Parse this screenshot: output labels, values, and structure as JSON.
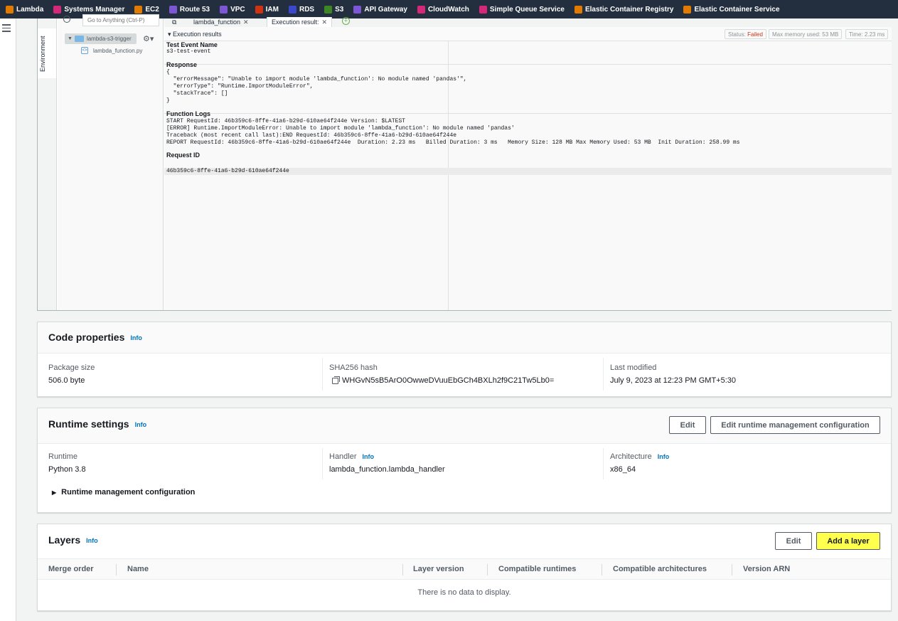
{
  "favorites": [
    {
      "label": "Lambda",
      "icon": "lambda-icon",
      "color": "#e07b00"
    },
    {
      "label": "Systems Manager",
      "icon": "systems-manager-icon",
      "color": "#d6287a"
    },
    {
      "label": "EC2",
      "icon": "ec2-icon",
      "color": "#e07b00"
    },
    {
      "label": "Route 53",
      "icon": "route53-icon",
      "color": "#7d56d6"
    },
    {
      "label": "VPC",
      "icon": "vpc-icon",
      "color": "#7d56d6"
    },
    {
      "label": "IAM",
      "icon": "iam-icon",
      "color": "#d13212"
    },
    {
      "label": "RDS",
      "icon": "rds-icon",
      "color": "#3b48cc"
    },
    {
      "label": "S3",
      "icon": "s3-icon",
      "color": "#3e8624"
    },
    {
      "label": "API Gateway",
      "icon": "api-gateway-icon",
      "color": "#7d56d6"
    },
    {
      "label": "CloudWatch",
      "icon": "cloudwatch-icon",
      "color": "#d6287a"
    },
    {
      "label": "Simple Queue Service",
      "icon": "sqs-icon",
      "color": "#d6287a"
    },
    {
      "label": "Elastic Container Registry",
      "icon": "ecr-icon",
      "color": "#e07b00"
    },
    {
      "label": "Elastic Container Service",
      "icon": "ecs-icon",
      "color": "#e07b00"
    }
  ],
  "ide": {
    "environment_label": "Environment",
    "search_placeholder": "Go to Anything (Ctrl-P)",
    "folder_name": "lambda-s3-trigger",
    "file_name": "lambda_function.py",
    "tabs": [
      {
        "label": "lambda_function"
      },
      {
        "label": "Execution result:"
      }
    ],
    "results": {
      "title": "Execution results",
      "status_label": "Status:",
      "status_value": "Failed",
      "max_memory": "Max memory used: 53 MB",
      "time": "Time: 2.23 ms",
      "test_event_title": "Test Event Name",
      "test_event_value": "s3-test-event",
      "response_title": "Response",
      "response_lines": [
        "{",
        "  \"errorMessage\": \"Unable to import module 'lambda_function': No module named 'pandas'\",",
        "  \"errorType\": \"Runtime.ImportModuleError\",",
        "  \"stackTrace\": []",
        "}"
      ],
      "logs_title": "Function Logs",
      "log_lines": [
        "START RequestId: 46b359c6-8ffe-41a6-b29d-610ae64f244e Version: $LATEST",
        "[ERROR] Runtime.ImportModuleError: Unable to import module 'lambda_function': No module named 'pandas'",
        "Traceback (most recent call last):END RequestId: 46b359c6-8ffe-41a6-b29d-610ae64f244e",
        "REPORT RequestId: 46b359c6-8ffe-41a6-b29d-610ae64f244e  Duration: 2.23 ms   Billed Duration: 3 ms   Memory Size: 128 MB Max Memory Used: 53 MB  Init Duration: 258.99 ms"
      ],
      "request_id_title": "Request ID",
      "request_id_value": "46b359c6-8ffe-41a6-b29d-610ae64f244e"
    }
  },
  "code_properties": {
    "title": "Code properties",
    "info": "Info",
    "package_size_label": "Package size",
    "package_size_value": "506.0 byte",
    "sha_label": "SHA256 hash",
    "sha_value": "WHGvN5sB5ArO0OwweDVuuEbGCh4BXLh2f9C21Tw5Lb0=",
    "last_modified_label": "Last modified",
    "last_modified_value": "July 9, 2023 at 12:23 PM GMT+5:30"
  },
  "runtime_settings": {
    "title": "Runtime settings",
    "info": "Info",
    "edit_label": "Edit",
    "edit_runtime_mgmt_label": "Edit runtime management configuration",
    "runtime_label": "Runtime",
    "runtime_value": "Python 3.8",
    "handler_label": "Handler",
    "handler_info": "Info",
    "handler_value": "lambda_function.lambda_handler",
    "arch_label": "Architecture",
    "arch_info": "Info",
    "arch_value": "x86_64",
    "runtime_mgmt_label": "Runtime management configuration"
  },
  "layers": {
    "title": "Layers",
    "info": "Info",
    "edit_label": "Edit",
    "add_layer_label": "Add a layer",
    "columns": [
      "Merge order",
      "Name",
      "Layer version",
      "Compatible runtimes",
      "Compatible architectures",
      "Version ARN"
    ],
    "empty_text": "There is no data to display."
  }
}
